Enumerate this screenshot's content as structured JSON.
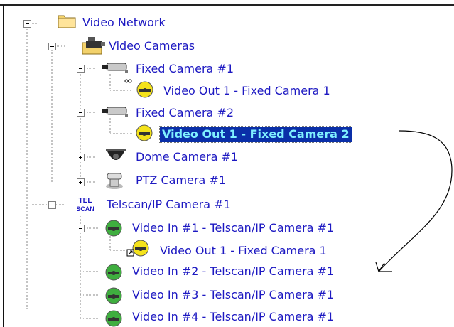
{
  "tree": {
    "nodes": [
      {
        "label": "Video Network",
        "icon": "folder-icon",
        "expander": "minus"
      },
      {
        "label": "Video Cameras",
        "icon": "camera-folder-icon",
        "expander": "minus"
      },
      {
        "label": "Fixed Camera #1",
        "icon": "fixed-camera-icon",
        "expander": "minus"
      },
      {
        "label": "Video Out 1 - Fixed Camera 1",
        "icon": "video-out-icon"
      },
      {
        "label": "Fixed Camera #2",
        "icon": "fixed-camera-icon",
        "expander": "minus"
      },
      {
        "label": "Video Out 1 - Fixed Camera 2",
        "icon": "video-out-icon",
        "selected": true
      },
      {
        "label": "Dome Camera #1",
        "icon": "dome-camera-icon",
        "expander": "plus"
      },
      {
        "label": "PTZ Camera #1",
        "icon": "ptz-camera-icon",
        "expander": "plus"
      },
      {
        "label": "Telscan/IP Camera #1",
        "icon": "telscan-icon",
        "icon_text": [
          "TEL",
          "SCAN"
        ],
        "expander": "minus"
      },
      {
        "label": "Video In #1 - Telscan/IP Camera #1",
        "icon": "video-in-icon",
        "expander": "minus"
      },
      {
        "label": "Video Out 1 - Fixed Camera 1",
        "icon": "video-out-shortcut-icon"
      },
      {
        "label": "Video In #2 - Telscan/IP Camera #1",
        "icon": "video-in-icon"
      },
      {
        "label": "Video In #3 - Telscan/IP Camera #1",
        "icon": "video-in-icon"
      },
      {
        "label": "Video In #4 - Telscan/IP Camera #1",
        "icon": "video-in-icon"
      }
    ]
  },
  "colors": {
    "label": "#1d19c2",
    "selection_bg": "#0a2fa8",
    "selection_text": "#7ff0ff",
    "video_out": "#f4e21b",
    "video_in": "#3fae3f"
  }
}
